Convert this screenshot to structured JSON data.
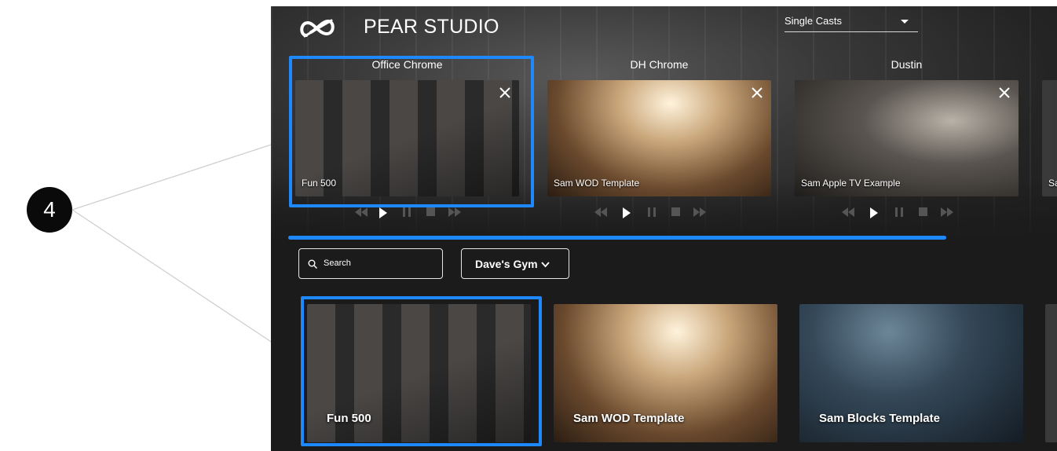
{
  "callout": {
    "number": "4"
  },
  "header": {
    "app_name": "PEAR STUDIO",
    "mode_select": {
      "value": "Single Casts"
    }
  },
  "devices": [
    {
      "name": "Office Chrome",
      "playing": "Fun 500",
      "selected": true
    },
    {
      "name": "DH Chrome",
      "playing": "Sam WOD Template",
      "selected": false
    },
    {
      "name": "Dustin",
      "playing": "Sam Apple TV Example",
      "selected": false
    },
    {
      "name": "",
      "playing": "Sa",
      "selected": false
    }
  ],
  "library": {
    "search": {
      "placeholder": "Search"
    },
    "gym_select": {
      "value": "Dave's Gym"
    },
    "cards": [
      {
        "title": "Fun 500",
        "selected": true
      },
      {
        "title": "Sam WOD Template",
        "selected": false
      },
      {
        "title": "Sam Blocks Template",
        "selected": false
      }
    ]
  },
  "colors": {
    "accent": "#1e88ff",
    "app_background": "#1b1b1b",
    "text": "#ffffff"
  },
  "icons": {
    "logo": "pear-logo-icon",
    "close": "close-icon",
    "rewind": "rewind-icon",
    "play": "play-icon",
    "pause": "pause-icon",
    "stop": "stop-icon",
    "forward": "fast-forward-icon",
    "search": "search-icon",
    "chevron": "chevron-down-icon"
  }
}
